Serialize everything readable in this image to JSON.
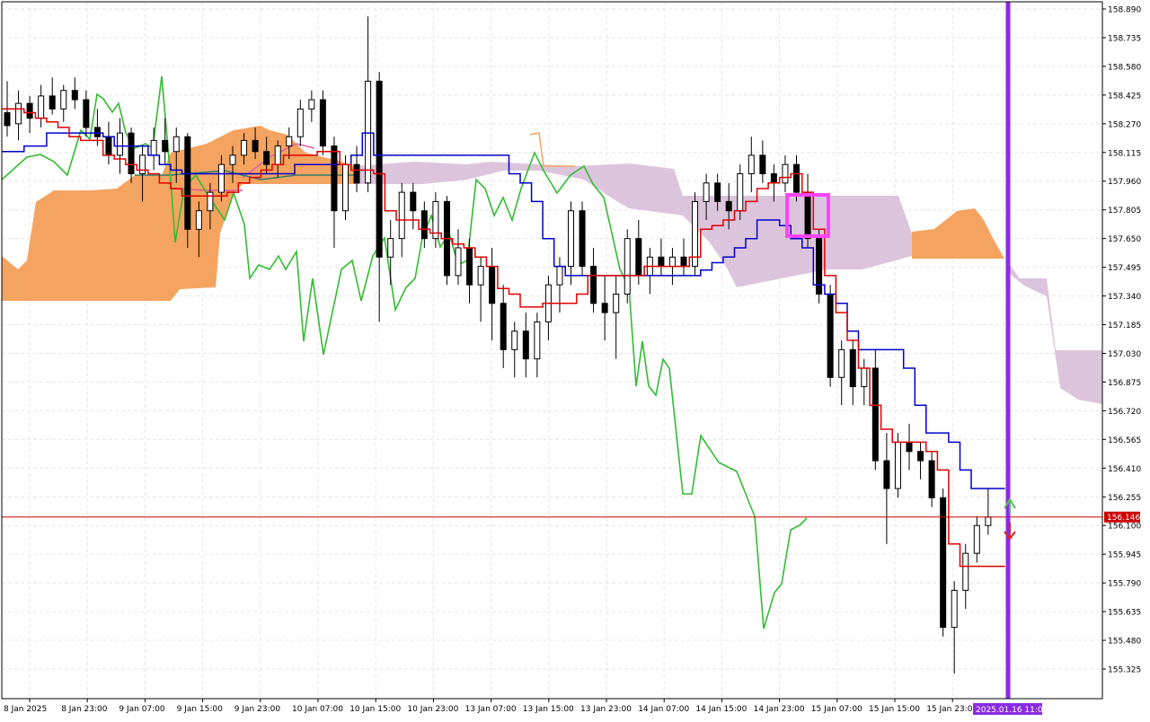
{
  "chart_data": {
    "type": "candlestick",
    "instrument_note": "",
    "y_axis": {
      "ylim": [
        155.2,
        158.95
      ],
      "tick_labels": [
        "158.890",
        "158.735",
        "158.580",
        "158.425",
        "158.270",
        "158.115",
        "157.960",
        "157.805",
        "157.650",
        "157.495",
        "157.340",
        "157.185",
        "157.030",
        "156.875",
        "156.720",
        "156.565",
        "156.410",
        "156.255",
        "156.100",
        "155.945",
        "155.790",
        "155.635",
        "155.480",
        "155.325"
      ]
    },
    "x_axis": {
      "tick_labels": [
        "8 Jan 2025",
        "8 Jan 23:00",
        "9 Jan 07:00",
        "9 Jan 15:00",
        "9 Jan 23:00",
        "10 Jan 07:00",
        "10 Jan 15:00",
        "10 Jan 23:00",
        "13 Jan 07:00",
        "13 Jan 15:00",
        "13 Jan 23:00",
        "14 Jan 07:00",
        "14 Jan 15:00",
        "14 Jan 23:00",
        "15 Jan 07:00",
        "15 Jan 15:00",
        "15 Jan 23:00"
      ],
      "cursor_label": "2025.01.16 11:00"
    },
    "current_price": {
      "label": "156.146",
      "value": 156.146,
      "color": "#cc0000"
    },
    "grid": true,
    "colors": {
      "bull_candle": "#ffffff",
      "bear_candle": "#000000",
      "tenkan": "#e00000",
      "kijun": "#0000cc",
      "chikou": "#33bb33",
      "kumo_bull": "#f4a460",
      "kumo_bear": "#d8bfd8",
      "highlight_box": "#ff44ff",
      "cursor_line": "#8a2be2"
    },
    "candles": [
      {
        "o": 158.33,
        "h": 158.5,
        "l": 158.2,
        "c": 158.26
      },
      {
        "o": 158.27,
        "h": 158.45,
        "l": 158.18,
        "c": 158.38
      },
      {
        "o": 158.38,
        "h": 158.42,
        "l": 158.22,
        "c": 158.3
      },
      {
        "o": 158.3,
        "h": 158.48,
        "l": 158.25,
        "c": 158.42
      },
      {
        "o": 158.42,
        "h": 158.52,
        "l": 158.32,
        "c": 158.35
      },
      {
        "o": 158.35,
        "h": 158.48,
        "l": 158.28,
        "c": 158.45
      },
      {
        "o": 158.45,
        "h": 158.52,
        "l": 158.35,
        "c": 158.4
      },
      {
        "o": 158.4,
        "h": 158.45,
        "l": 158.2,
        "c": 158.25
      },
      {
        "o": 158.25,
        "h": 158.35,
        "l": 158.15,
        "c": 158.2
      },
      {
        "o": 158.2,
        "h": 158.28,
        "l": 158.05,
        "c": 158.1
      },
      {
        "o": 158.1,
        "h": 158.3,
        "l": 158.0,
        "c": 158.22
      },
      {
        "o": 158.22,
        "h": 158.25,
        "l": 157.95,
        "c": 158.0
      },
      {
        "o": 158.0,
        "h": 158.15,
        "l": 157.85,
        "c": 158.1
      },
      {
        "o": 158.1,
        "h": 158.25,
        "l": 158.02,
        "c": 158.18
      },
      {
        "o": 158.18,
        "h": 158.3,
        "l": 158.05,
        "c": 158.12
      },
      {
        "o": 158.12,
        "h": 158.25,
        "l": 157.95,
        "c": 158.2
      },
      {
        "o": 158.2,
        "h": 158.22,
        "l": 157.6,
        "c": 157.7
      },
      {
        "o": 157.7,
        "h": 157.85,
        "l": 157.55,
        "c": 157.8
      },
      {
        "o": 157.8,
        "h": 157.95,
        "l": 157.7,
        "c": 157.9
      },
      {
        "o": 157.9,
        "h": 158.1,
        "l": 157.85,
        "c": 158.05
      },
      {
        "o": 158.05,
        "h": 158.15,
        "l": 157.95,
        "c": 158.1
      },
      {
        "o": 158.1,
        "h": 158.22,
        "l": 158.05,
        "c": 158.18
      },
      {
        "o": 158.18,
        "h": 158.25,
        "l": 158.08,
        "c": 158.12
      },
      {
        "o": 158.12,
        "h": 158.2,
        "l": 158.0,
        "c": 158.05
      },
      {
        "o": 158.05,
        "h": 158.18,
        "l": 157.98,
        "c": 158.15
      },
      {
        "o": 158.15,
        "h": 158.25,
        "l": 158.08,
        "c": 158.2
      },
      {
        "o": 158.2,
        "h": 158.4,
        "l": 158.15,
        "c": 158.35
      },
      {
        "o": 158.35,
        "h": 158.45,
        "l": 158.28,
        "c": 158.4
      },
      {
        "o": 158.4,
        "h": 158.45,
        "l": 158.1,
        "c": 158.15
      },
      {
        "o": 158.15,
        "h": 158.2,
        "l": 157.6,
        "c": 157.8
      },
      {
        "o": 157.8,
        "h": 158.1,
        "l": 157.75,
        "c": 158.05
      },
      {
        "o": 158.05,
        "h": 158.15,
        "l": 157.9,
        "c": 157.95
      },
      {
        "o": 157.95,
        "h": 158.85,
        "l": 157.9,
        "c": 158.5
      },
      {
        "o": 158.5,
        "h": 158.55,
        "l": 157.2,
        "c": 157.55
      },
      {
        "o": 157.55,
        "h": 157.75,
        "l": 157.4,
        "c": 157.65
      },
      {
        "o": 157.65,
        "h": 157.95,
        "l": 157.55,
        "c": 157.9
      },
      {
        "o": 157.9,
        "h": 157.95,
        "l": 157.7,
        "c": 157.8
      },
      {
        "o": 157.8,
        "h": 157.85,
        "l": 157.6,
        "c": 157.65
      },
      {
        "o": 157.65,
        "h": 157.9,
        "l": 157.6,
        "c": 157.85
      },
      {
        "o": 157.85,
        "h": 157.88,
        "l": 157.4,
        "c": 157.45
      },
      {
        "o": 157.45,
        "h": 157.7,
        "l": 157.4,
        "c": 157.6
      },
      {
        "o": 157.6,
        "h": 157.65,
        "l": 157.3,
        "c": 157.4
      },
      {
        "o": 157.4,
        "h": 157.55,
        "l": 157.2,
        "c": 157.5
      },
      {
        "o": 157.5,
        "h": 157.6,
        "l": 157.1,
        "c": 157.3
      },
      {
        "o": 157.3,
        "h": 157.4,
        "l": 156.95,
        "c": 157.05
      },
      {
        "o": 157.05,
        "h": 157.2,
        "l": 156.9,
        "c": 157.15
      },
      {
        "o": 157.15,
        "h": 157.25,
        "l": 156.9,
        "c": 157.0
      },
      {
        "o": 157.0,
        "h": 157.25,
        "l": 156.9,
        "c": 157.2
      },
      {
        "o": 157.2,
        "h": 157.45,
        "l": 157.1,
        "c": 157.4
      },
      {
        "o": 157.4,
        "h": 157.55,
        "l": 157.25,
        "c": 157.5
      },
      {
        "o": 157.5,
        "h": 157.85,
        "l": 157.4,
        "c": 157.8
      },
      {
        "o": 157.8,
        "h": 157.85,
        "l": 157.45,
        "c": 157.5
      },
      {
        "o": 157.5,
        "h": 157.6,
        "l": 157.25,
        "c": 157.3
      },
      {
        "o": 157.3,
        "h": 157.45,
        "l": 157.1,
        "c": 157.25
      },
      {
        "o": 157.25,
        "h": 157.45,
        "l": 157.0,
        "c": 157.35
      },
      {
        "o": 157.35,
        "h": 157.7,
        "l": 157.3,
        "c": 157.65
      },
      {
        "o": 157.65,
        "h": 157.75,
        "l": 157.4,
        "c": 157.45
      },
      {
        "o": 157.45,
        "h": 157.6,
        "l": 157.35,
        "c": 157.55
      },
      {
        "o": 157.55,
        "h": 157.65,
        "l": 157.45,
        "c": 157.5
      },
      {
        "o": 157.5,
        "h": 157.6,
        "l": 157.4,
        "c": 157.55
      },
      {
        "o": 157.55,
        "h": 157.65,
        "l": 157.45,
        "c": 157.5
      },
      {
        "o": 157.5,
        "h": 157.9,
        "l": 157.45,
        "c": 157.85
      },
      {
        "o": 157.85,
        "h": 158.0,
        "l": 157.75,
        "c": 157.95
      },
      {
        "o": 157.95,
        "h": 158.0,
        "l": 157.8,
        "c": 157.85
      },
      {
        "o": 157.85,
        "h": 157.95,
        "l": 157.7,
        "c": 157.8
      },
      {
        "o": 157.8,
        "h": 158.05,
        "l": 157.75,
        "c": 158.0
      },
      {
        "o": 158.0,
        "h": 158.2,
        "l": 157.9,
        "c": 158.1
      },
      {
        "o": 158.1,
        "h": 158.18,
        "l": 157.95,
        "c": 158.0
      },
      {
        "o": 158.0,
        "h": 158.05,
        "l": 157.85,
        "c": 157.95
      },
      {
        "o": 157.95,
        "h": 158.1,
        "l": 157.9,
        "c": 158.05
      },
      {
        "o": 158.05,
        "h": 158.1,
        "l": 157.85,
        "c": 157.9
      },
      {
        "o": 157.9,
        "h": 158.0,
        "l": 157.6,
        "c": 157.65
      },
      {
        "o": 157.65,
        "h": 157.7,
        "l": 157.3,
        "c": 157.35
      },
      {
        "o": 157.35,
        "h": 157.4,
        "l": 156.85,
        "c": 156.9
      },
      {
        "o": 156.9,
        "h": 157.1,
        "l": 156.75,
        "c": 157.05
      },
      {
        "o": 157.05,
        "h": 157.1,
        "l": 156.75,
        "c": 156.85
      },
      {
        "o": 156.85,
        "h": 157.0,
        "l": 156.75,
        "c": 156.95
      },
      {
        "o": 156.95,
        "h": 157.05,
        "l": 156.4,
        "c": 156.45
      },
      {
        "o": 156.45,
        "h": 156.6,
        "l": 156.0,
        "c": 156.3
      },
      {
        "o": 156.3,
        "h": 156.6,
        "l": 156.25,
        "c": 156.55
      },
      {
        "o": 156.55,
        "h": 156.65,
        "l": 156.4,
        "c": 156.5
      },
      {
        "o": 156.5,
        "h": 156.55,
        "l": 156.35,
        "c": 156.45
      },
      {
        "o": 156.45,
        "h": 156.5,
        "l": 156.2,
        "c": 156.25
      },
      {
        "o": 156.25,
        "h": 156.3,
        "l": 155.5,
        "c": 155.55
      },
      {
        "o": 155.55,
        "h": 155.8,
        "l": 155.3,
        "c": 155.75
      },
      {
        "o": 155.75,
        "h": 156.0,
        "l": 155.65,
        "c": 155.95
      },
      {
        "o": 155.95,
        "h": 156.15,
        "l": 155.9,
        "c": 156.1
      },
      {
        "o": 156.1,
        "h": 156.3,
        "l": 156.05,
        "c": 156.146
      }
    ],
    "tenkan": [
      158.35,
      158.35,
      158.33,
      158.3,
      158.28,
      158.25,
      158.2,
      158.18,
      158.18,
      158.1,
      158.08,
      158.05,
      158.02,
      158.0,
      157.95,
      157.92,
      157.88,
      157.88,
      157.88,
      157.88,
      157.9,
      157.95,
      157.98,
      158.02,
      158.05,
      158.1,
      158.1,
      158.1,
      158.12,
      158.12,
      158.05,
      158.02,
      158.02,
      158.0,
      157.8,
      157.75,
      157.75,
      157.7,
      157.68,
      157.65,
      157.62,
      157.6,
      157.55,
      157.5,
      157.38,
      157.35,
      157.28,
      157.28,
      157.3,
      157.3,
      157.3,
      157.35,
      157.45,
      157.45,
      157.45,
      157.45,
      157.45,
      157.5,
      157.5,
      157.5,
      157.5,
      157.55,
      157.7,
      157.72,
      157.75,
      157.8,
      157.85,
      157.92,
      157.95,
      157.98,
      158.0,
      157.9,
      157.7,
      157.45,
      157.25,
      157.1,
      156.95,
      156.75,
      156.62,
      156.55,
      156.55,
      156.55,
      156.5,
      156.4,
      156.0,
      155.88,
      155.88,
      155.88,
      155.88
    ],
    "kijun": [
      158.12,
      158.12,
      158.15,
      158.15,
      158.22,
      158.22,
      158.22,
      158.22,
      158.22,
      158.2,
      158.15,
      158.15,
      158.15,
      158.1,
      158.05,
      158.02,
      158.0,
      158.0,
      158.0,
      158.0,
      158.0,
      158.0,
      158.0,
      158.0,
      158.0,
      158.0,
      158.05,
      158.05,
      158.05,
      158.05,
      158.05,
      158.1,
      158.22,
      158.1,
      158.1,
      158.1,
      158.1,
      158.1,
      158.1,
      158.1,
      158.1,
      158.1,
      158.1,
      158.1,
      158.1,
      158.0,
      157.95,
      157.85,
      157.65,
      157.5,
      157.45,
      157.45,
      157.45,
      157.45,
      157.45,
      157.45,
      157.45,
      157.45,
      157.45,
      157.45,
      157.45,
      157.45,
      157.48,
      157.52,
      157.55,
      157.6,
      157.65,
      157.75,
      157.75,
      157.72,
      157.65,
      157.6,
      157.4,
      157.35,
      157.3,
      157.15,
      157.05,
      157.05,
      157.05,
      157.05,
      156.95,
      156.75,
      156.6,
      156.6,
      156.55,
      156.4,
      156.3,
      156.3,
      156.3
    ]
  }
}
